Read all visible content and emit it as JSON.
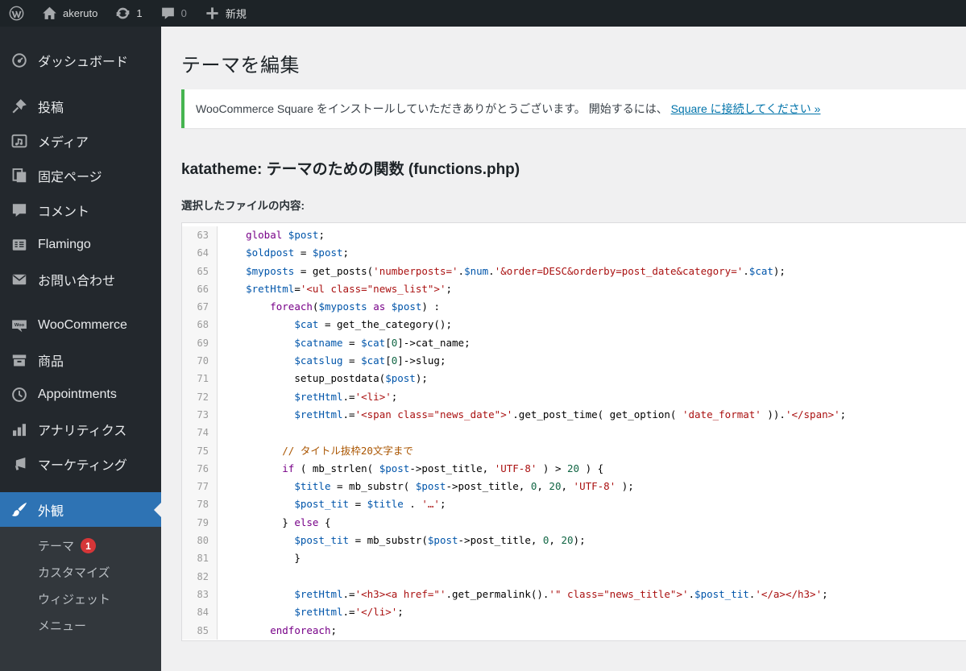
{
  "colors": {
    "accent": "#2e73b4",
    "badge": "#d63638",
    "green": "#46b450",
    "link": "#0073aa",
    "kw": "#770088",
    "var": "#0055aa",
    "str": "#aa1111",
    "com": "#aa5500",
    "num": "#116644"
  },
  "admin_bar": {
    "site_name": "akeruto",
    "updates_count": "1",
    "comments_count": "0",
    "new_label": "新規"
  },
  "sidebar": {
    "items": [
      {
        "name": "dashboard",
        "icon": "dashboard-icon",
        "label": "ダッシュボード"
      },
      {
        "separator": true
      },
      {
        "name": "posts",
        "icon": "pin-icon",
        "label": "投稿"
      },
      {
        "name": "media",
        "icon": "media-icon",
        "label": "メディア"
      },
      {
        "name": "pages",
        "icon": "pages-icon",
        "label": "固定ページ"
      },
      {
        "name": "comments",
        "icon": "comment-icon",
        "label": "コメント"
      },
      {
        "name": "flamingo",
        "icon": "flamingo-icon",
        "label": "Flamingo"
      },
      {
        "name": "contact",
        "icon": "mail-icon",
        "label": "お問い合わせ"
      },
      {
        "separator": true
      },
      {
        "name": "woocommerce",
        "icon": "woocommerce-icon",
        "label": "WooCommerce"
      },
      {
        "name": "products",
        "icon": "products-icon",
        "label": "商品"
      },
      {
        "name": "appointments",
        "icon": "clock-icon",
        "label": "Appointments"
      },
      {
        "name": "analytics",
        "icon": "analytics-icon",
        "label": "アナリティクス"
      },
      {
        "name": "marketing",
        "icon": "megaphone-icon",
        "label": "マーケティング"
      },
      {
        "separator": true
      },
      {
        "name": "appearance",
        "icon": "paintbrush-icon",
        "label": "外観",
        "current": true,
        "submenu": [
          {
            "name": "themes",
            "label": "テーマ",
            "badge": "1"
          },
          {
            "name": "customize",
            "label": "カスタマイズ"
          },
          {
            "name": "widgets",
            "label": "ウィジェット"
          },
          {
            "name": "menus",
            "label": "メニュー"
          }
        ]
      }
    ]
  },
  "main": {
    "page_title": "テーマを編集",
    "notice": {
      "text": "WooCommerce Square をインストールしていただきありがとうございます。 開始するには、 ",
      "link": "Square に接続してください »"
    },
    "file_heading": "katatheme: テーマのための関数 (functions.php)",
    "content_label": "選択したファイルの内容:"
  },
  "editor": {
    "lines": [
      {
        "no": 63,
        "indent": 4,
        "tokens": [
          [
            "k",
            "global"
          ],
          [
            "p",
            " "
          ],
          [
            "v",
            "$post"
          ],
          [
            "p",
            ";"
          ]
        ]
      },
      {
        "no": 64,
        "indent": 4,
        "tokens": [
          [
            "v",
            "$oldpost"
          ],
          [
            "p",
            " = "
          ],
          [
            "v",
            "$post"
          ],
          [
            "p",
            ";"
          ]
        ]
      },
      {
        "no": 65,
        "indent": 4,
        "tokens": [
          [
            "v",
            "$myposts"
          ],
          [
            "p",
            " = get_posts("
          ],
          [
            "s",
            "'numberposts='"
          ],
          [
            "p",
            "."
          ],
          [
            "v",
            "$num"
          ],
          [
            "p",
            "."
          ],
          [
            "s",
            "'&order=DESC&orderby=post_date&category='"
          ],
          [
            "p",
            "."
          ],
          [
            "v",
            "$cat"
          ],
          [
            "p",
            ");"
          ]
        ]
      },
      {
        "no": 66,
        "indent": 4,
        "tokens": [
          [
            "v",
            "$retHtml"
          ],
          [
            "p",
            "="
          ],
          [
            "s",
            "'<ul class=\"news_list\">'"
          ],
          [
            "p",
            ";"
          ]
        ]
      },
      {
        "no": 67,
        "indent": 8,
        "tokens": [
          [
            "k",
            "foreach"
          ],
          [
            "p",
            "("
          ],
          [
            "v",
            "$myposts"
          ],
          [
            "p",
            " "
          ],
          [
            "k",
            "as"
          ],
          [
            "p",
            " "
          ],
          [
            "v",
            "$post"
          ],
          [
            "p",
            ") :"
          ]
        ]
      },
      {
        "no": 68,
        "indent": 12,
        "tokens": [
          [
            "v",
            "$cat"
          ],
          [
            "p",
            " = get_the_category();"
          ]
        ]
      },
      {
        "no": 69,
        "indent": 12,
        "tokens": [
          [
            "v",
            "$catname"
          ],
          [
            "p",
            " = "
          ],
          [
            "v",
            "$cat"
          ],
          [
            "p",
            "["
          ],
          [
            "n",
            "0"
          ],
          [
            "p",
            "]->cat_name;"
          ]
        ]
      },
      {
        "no": 70,
        "indent": 12,
        "tokens": [
          [
            "v",
            "$catslug"
          ],
          [
            "p",
            " = "
          ],
          [
            "v",
            "$cat"
          ],
          [
            "p",
            "["
          ],
          [
            "n",
            "0"
          ],
          [
            "p",
            "]->slug;"
          ]
        ]
      },
      {
        "no": 71,
        "indent": 12,
        "tokens": [
          [
            "p",
            "setup_postdata("
          ],
          [
            "v",
            "$post"
          ],
          [
            "p",
            ");"
          ]
        ]
      },
      {
        "no": 72,
        "indent": 12,
        "tokens": [
          [
            "v",
            "$retHtml"
          ],
          [
            "p",
            ".="
          ],
          [
            "s",
            "'<li>'"
          ],
          [
            "p",
            ";"
          ]
        ]
      },
      {
        "no": 73,
        "indent": 12,
        "tokens": [
          [
            "v",
            "$retHtml"
          ],
          [
            "p",
            ".="
          ],
          [
            "s",
            "'<span class=\"news_date\">'"
          ],
          [
            "p",
            ".get_post_time( get_option( "
          ],
          [
            "s",
            "'date_format'"
          ],
          [
            "p",
            " ))."
          ],
          [
            "s",
            "'</span>'"
          ],
          [
            "p",
            ";"
          ]
        ]
      },
      {
        "no": 74,
        "indent": 0,
        "tokens": []
      },
      {
        "no": 75,
        "indent": 10,
        "tokens": [
          [
            "c",
            "// タイトル抜枠20文字まで"
          ]
        ]
      },
      {
        "no": 76,
        "indent": 10,
        "tokens": [
          [
            "k",
            "if"
          ],
          [
            "p",
            " ( mb_strlen( "
          ],
          [
            "v",
            "$post"
          ],
          [
            "p",
            "->post_title, "
          ],
          [
            "s",
            "'UTF-8'"
          ],
          [
            "p",
            " ) > "
          ],
          [
            "n",
            "20"
          ],
          [
            "p",
            " ) {"
          ]
        ]
      },
      {
        "no": 77,
        "indent": 12,
        "tokens": [
          [
            "v",
            "$title"
          ],
          [
            "p",
            " = mb_substr( "
          ],
          [
            "v",
            "$post"
          ],
          [
            "p",
            "->post_title, "
          ],
          [
            "n",
            "0"
          ],
          [
            "p",
            ", "
          ],
          [
            "n",
            "20"
          ],
          [
            "p",
            ", "
          ],
          [
            "s",
            "'UTF-8'"
          ],
          [
            "p",
            " );"
          ]
        ]
      },
      {
        "no": 78,
        "indent": 12,
        "tokens": [
          [
            "v",
            "$post_tit"
          ],
          [
            "p",
            " = "
          ],
          [
            "v",
            "$title"
          ],
          [
            "p",
            " . "
          ],
          [
            "s",
            "'…'"
          ],
          [
            "p",
            ";"
          ]
        ]
      },
      {
        "no": 79,
        "indent": 10,
        "tokens": [
          [
            "p",
            "} "
          ],
          [
            "k",
            "else"
          ],
          [
            "p",
            " {"
          ]
        ]
      },
      {
        "no": 80,
        "indent": 12,
        "tokens": [
          [
            "v",
            "$post_tit"
          ],
          [
            "p",
            " = mb_substr("
          ],
          [
            "v",
            "$post"
          ],
          [
            "p",
            "->post_title, "
          ],
          [
            "n",
            "0"
          ],
          [
            "p",
            ", "
          ],
          [
            "n",
            "20"
          ],
          [
            "p",
            ");"
          ]
        ]
      },
      {
        "no": 81,
        "indent": 12,
        "tokens": [
          [
            "p",
            "}"
          ]
        ]
      },
      {
        "no": 82,
        "indent": 0,
        "tokens": []
      },
      {
        "no": 83,
        "indent": 12,
        "tokens": [
          [
            "v",
            "$retHtml"
          ],
          [
            "p",
            ".="
          ],
          [
            "s",
            "'<h3><a href=\"'"
          ],
          [
            "p",
            ".get_permalink()."
          ],
          [
            "s",
            "'\" class=\"news_title\">'"
          ],
          [
            "p",
            "."
          ],
          [
            "v",
            "$post_tit"
          ],
          [
            "p",
            "."
          ],
          [
            "s",
            "'</a></h3>'"
          ],
          [
            "p",
            ";"
          ]
        ]
      },
      {
        "no": 84,
        "indent": 12,
        "tokens": [
          [
            "v",
            "$retHtml"
          ],
          [
            "p",
            ".="
          ],
          [
            "s",
            "'</li>'"
          ],
          [
            "p",
            ";"
          ]
        ]
      },
      {
        "no": 85,
        "indent": 8,
        "tokens": [
          [
            "k",
            "endforeach"
          ],
          [
            "p",
            ";"
          ]
        ]
      }
    ]
  }
}
